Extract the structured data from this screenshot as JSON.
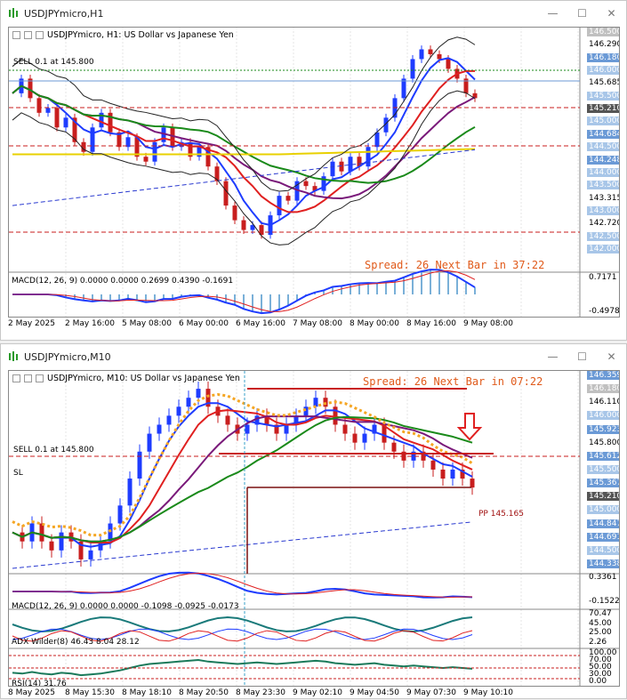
{
  "top": {
    "window_title": "USDJPYmicro,H1",
    "chart_header": "USDJPYmicro, H1:  US Dollar vs Japanese Yen",
    "sell_label": "SELL 0.1 at 145.800",
    "spread_text": "Spread: 26  Next Bar in 37:22",
    "macd_label": "MACD(12, 26, 9) 0.0000 0.0000 0.2699 0.4390 -0.1691",
    "price_ticks": [
      {
        "v": "146.500",
        "kind": "box",
        "color": "#c0c0c0"
      },
      {
        "v": "146.290",
        "kind": "plain"
      },
      {
        "v": "146.180",
        "kind": "box",
        "color": "#6b9ad6"
      },
      {
        "v": "146.000",
        "kind": "box",
        "color": "#a8c6e8"
      },
      {
        "v": "145.685",
        "kind": "plain"
      },
      {
        "v": "145.500",
        "kind": "box",
        "color": "#a8c6e8"
      },
      {
        "v": "145.210",
        "kind": "box",
        "color": "#555555"
      },
      {
        "v": "145.000",
        "kind": "box",
        "color": "#a8c6e8"
      },
      {
        "v": "144.684",
        "kind": "box",
        "color": "#6b9ad6"
      },
      {
        "v": "144.500",
        "kind": "box",
        "color": "#a8c6e8"
      },
      {
        "v": "144.248",
        "kind": "box",
        "color": "#6b9ad6"
      },
      {
        "v": "144.000",
        "kind": "box",
        "color": "#a8c6e8"
      },
      {
        "v": "143.500",
        "kind": "box",
        "color": "#a8c6e8"
      },
      {
        "v": "143.315",
        "kind": "plain"
      },
      {
        "v": "143.000",
        "kind": "box",
        "color": "#a8c6e8"
      },
      {
        "v": "142.720",
        "kind": "plain"
      },
      {
        "v": "142.500",
        "kind": "box",
        "color": "#a8c6e8"
      },
      {
        "v": "142.000",
        "kind": "box",
        "color": "#a8c6e8"
      }
    ],
    "macd_ticks": [
      "0.7171",
      "-0.4978"
    ],
    "time_labels": [
      "2 May 2025",
      "2 May 16:00",
      "5 May 08:00",
      "6 May 00:00",
      "6 May 16:00",
      "7 May 08:00",
      "8 May 00:00",
      "8 May 16:00",
      "9 May 08:00"
    ]
  },
  "bottom": {
    "window_title": "USDJPYmicro,M10",
    "chart_header": "USDJPYmicro, M10:  US Dollar vs Japanese Yen",
    "sell_label": "SELL 0.1 at 145.800",
    "sl_label": "SL",
    "spread_text": "Spread: 26  Next Bar in 07:22",
    "pp_label": "PP 145.165",
    "macd_label": "MACD(12, 26, 9) 0.0000 0.0000 -0.1098 -0.0925 -0.0173",
    "adx_label": "ADX Wilder(8) 46.43 8.04 28.12",
    "rsi_label": "RSI(14) 31.76",
    "price_ticks": [
      {
        "v": "146.359",
        "kind": "box",
        "color": "#6b9ad6"
      },
      {
        "v": "146.180",
        "kind": "box",
        "color": "#c0c0c0"
      },
      {
        "v": "146.110",
        "kind": "plain"
      },
      {
        "v": "146.000",
        "kind": "box",
        "color": "#a8c6e8"
      },
      {
        "v": "145.923",
        "kind": "box",
        "color": "#6b9ad6"
      },
      {
        "v": "145.800",
        "kind": "plain"
      },
      {
        "v": "145.612",
        "kind": "box",
        "color": "#6b9ad6"
      },
      {
        "v": "145.500",
        "kind": "box",
        "color": "#a8c6e8"
      },
      {
        "v": "145.367",
        "kind": "box",
        "color": "#6b9ad6"
      },
      {
        "v": "145.210",
        "kind": "box",
        "color": "#555555"
      },
      {
        "v": "145.000",
        "kind": "box",
        "color": "#a8c6e8"
      },
      {
        "v": "144.847",
        "kind": "box",
        "color": "#6b9ad6"
      },
      {
        "v": "144.691",
        "kind": "box",
        "color": "#6b9ad6"
      },
      {
        "v": "144.500",
        "kind": "box",
        "color": "#a8c6e8"
      },
      {
        "v": "144.338",
        "kind": "box",
        "color": "#6b9ad6"
      }
    ],
    "macd_ticks": [
      "0.3361",
      "-0.1522"
    ],
    "adx_ticks": [
      "70.47",
      "45.00",
      "25.00",
      "2.26"
    ],
    "rsi_ticks": [
      "100.00",
      "70.00",
      "50.00",
      "30.00",
      "0.00"
    ],
    "time_labels": [
      "8 May 2025",
      "8 May 15:30",
      "8 May 18:10",
      "8 May 20:50",
      "8 May 23:30",
      "9 May 02:10",
      "9 May 04:50",
      "9 May 07:30",
      "9 May 10:10"
    ]
  },
  "colors": {
    "bull": "#1e3cff",
    "bear": "#c81e1e",
    "spread": "#e05a1a",
    "ma_red": "#e02020",
    "ma_green": "#1a8a1a",
    "ma_purple": "#7a1a7a",
    "ma_yellow": "#e8d000",
    "ma_orange": "#f5a623"
  }
}
